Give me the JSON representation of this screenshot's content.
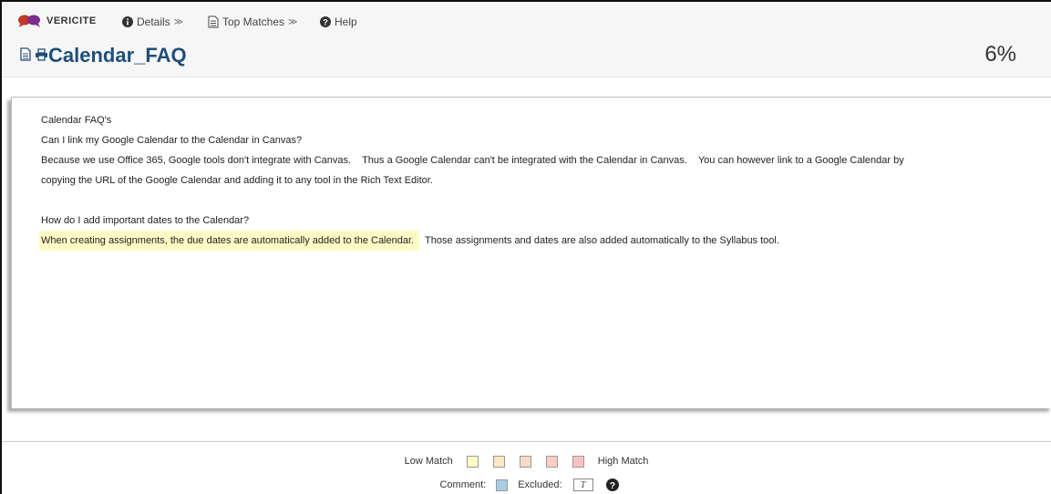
{
  "nav": {
    "brand": "VERICITE",
    "details": "Details",
    "top_matches": "Top Matches",
    "help": "Help",
    "chevron": "≫"
  },
  "header": {
    "title": "Calendar_FAQ",
    "score": "6%"
  },
  "document": {
    "line1": "Calendar FAQ's",
    "line2": "Can I link my Google Calendar to the Calendar in Canvas?",
    "line3": "Because we use Office 365, Google tools don't integrate with Canvas.    Thus a Google Calendar can't be integrated with the Calendar in Canvas.    You can however link to a Google Calendar by",
    "line4": "copying the URL of the Google Calendar and adding it to any tool in the Rich Text Editor.",
    "line5": "How do I add important dates to the Calendar?",
    "line6_highlight": "When creating assignments, the due dates are automatically added to the Calendar.",
    "line6_rest": "  Those assignments and dates are also added automatically to the Syllabus tool."
  },
  "legend": {
    "low_match": "Low Match",
    "high_match": "High Match",
    "swatch_colors": [
      "#fefbc6",
      "#fde8c4",
      "#fcd9c4",
      "#fbcec4",
      "#f8c2c2"
    ],
    "comment_label": "Comment:",
    "comment_color": "#a9cde5",
    "excluded_label": "Excluded:",
    "excluded_symbol": "T"
  },
  "colors": {
    "title": "#1f4e79",
    "highlight": "#fefbc6",
    "brand_red": "#c0392b"
  }
}
